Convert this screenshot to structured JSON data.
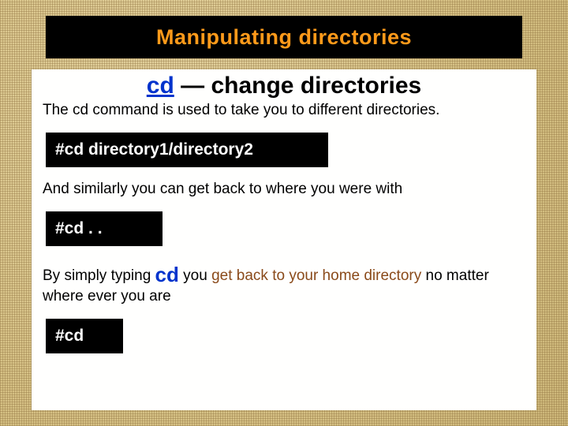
{
  "title": "Manipulating directories",
  "heading_cmd": "cd",
  "heading_rest": " — change directories",
  "p1_a": "The ",
  "p1_cmd": "cd",
  "p1_b": " command is used to take you to different directories.",
  "code1": "#cd directory1/directory2",
  "p2": "And similarly you can get back to where you were with",
  "code2": "#cd . .",
  "p3_a": "By simply typing ",
  "p3_cmd": "cd",
  "p3_b": " you ",
  "p3_brown": "get back to your home directory",
  "p3_c": " no matter where ever you are",
  "code3": "#cd"
}
